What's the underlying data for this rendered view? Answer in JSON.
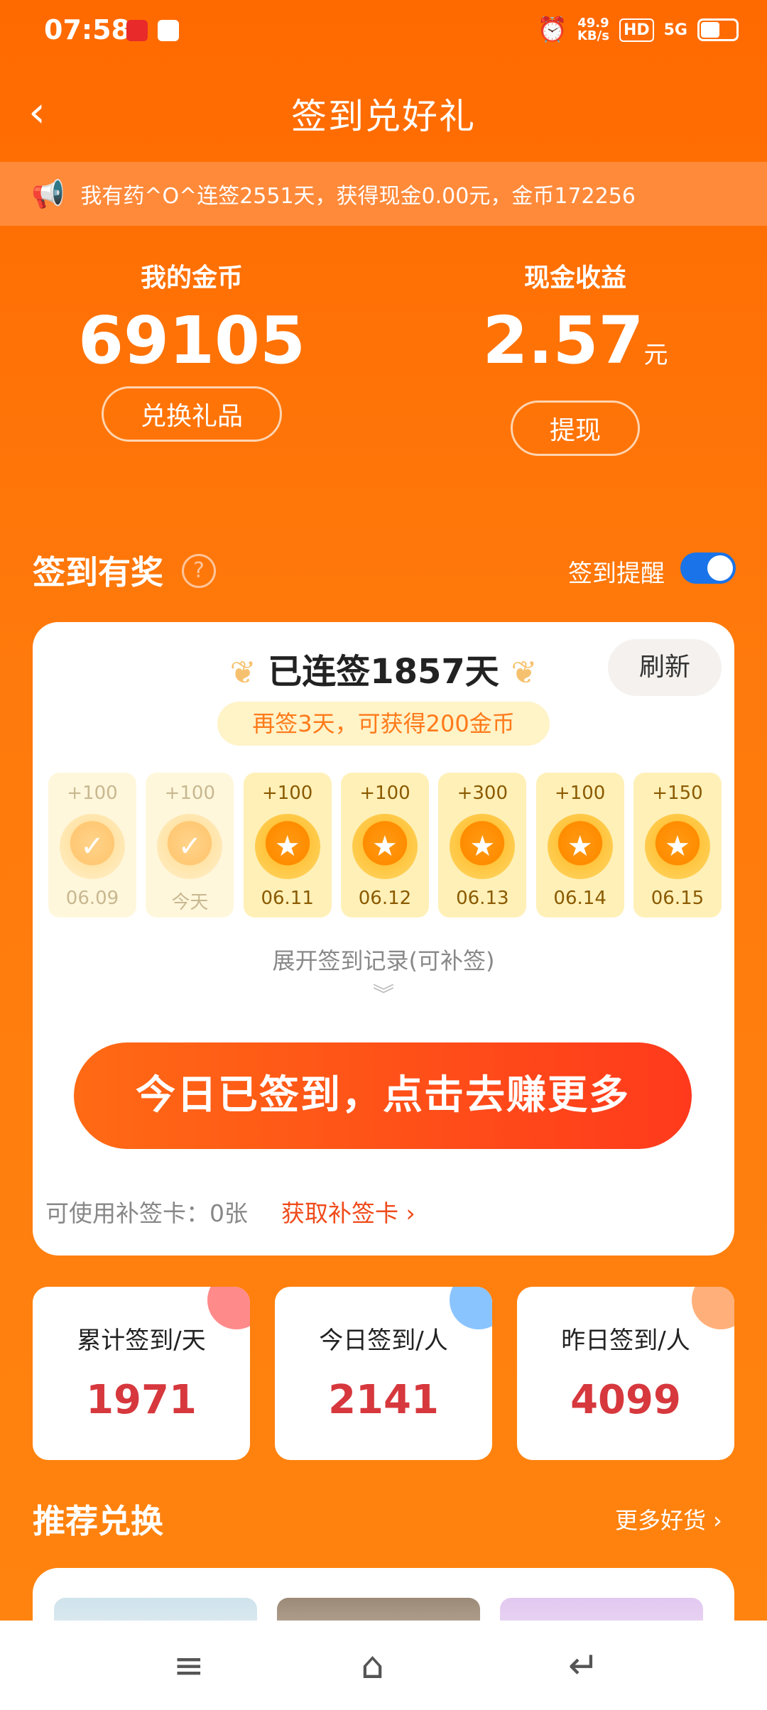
{
  "status_bar": {
    "time": "07:58",
    "net_speed_top": "49.9",
    "net_speed_bottom": "KB/s",
    "hd": "HD",
    "signal": "5G"
  },
  "header": {
    "title": "签到兑好礼",
    "back_icon": "chevron-left"
  },
  "notice": {
    "icon": "megaphone-icon",
    "text": "我有药^O^连签2551天，获得现金0.00元，金币172256"
  },
  "stats": {
    "coins": {
      "label": "我的金币",
      "value": "69105",
      "button": "兑换礼品"
    },
    "cash": {
      "label": "现金收益",
      "value": "2.57",
      "unit": "元",
      "button": "提现"
    }
  },
  "signin": {
    "title": "签到有奖",
    "help_icon": "?",
    "reminder_label": "签到提醒",
    "reminder_on": true,
    "streak": "已连签1857天",
    "refresh": "刷新",
    "tip": "再签3天，可获得200金币",
    "days": [
      {
        "points": "+100",
        "date": "06.09",
        "done": true
      },
      {
        "points": "+100",
        "date": "今天",
        "done": true
      },
      {
        "points": "+100",
        "date": "06.11",
        "done": false
      },
      {
        "points": "+100",
        "date": "06.12",
        "done": false
      },
      {
        "points": "+300",
        "date": "06.13",
        "done": false
      },
      {
        "points": "+100",
        "date": "06.14",
        "done": false
      },
      {
        "points": "+150",
        "date": "06.15",
        "done": false
      }
    ],
    "expand": "展开签到记录(可补签)",
    "cta": "今日已签到，点击去赚更多",
    "makeup_cards": "可使用补签卡：0张",
    "get_cards": "获取补签卡 ›"
  },
  "boxes": [
    {
      "label": "累计签到/天",
      "value": "1971",
      "dot": "#ff8a8a"
    },
    {
      "label": "今日签到/人",
      "value": "2141",
      "dot": "#8ac4ff"
    },
    {
      "label": "昨日签到/人",
      "value": "4099",
      "dot": "#ffb07a"
    }
  ],
  "recommend": {
    "title": "推荐兑换",
    "more": "更多好货 ›"
  },
  "nav": {
    "menu": "≡",
    "home": "⌂",
    "back": "↵"
  }
}
